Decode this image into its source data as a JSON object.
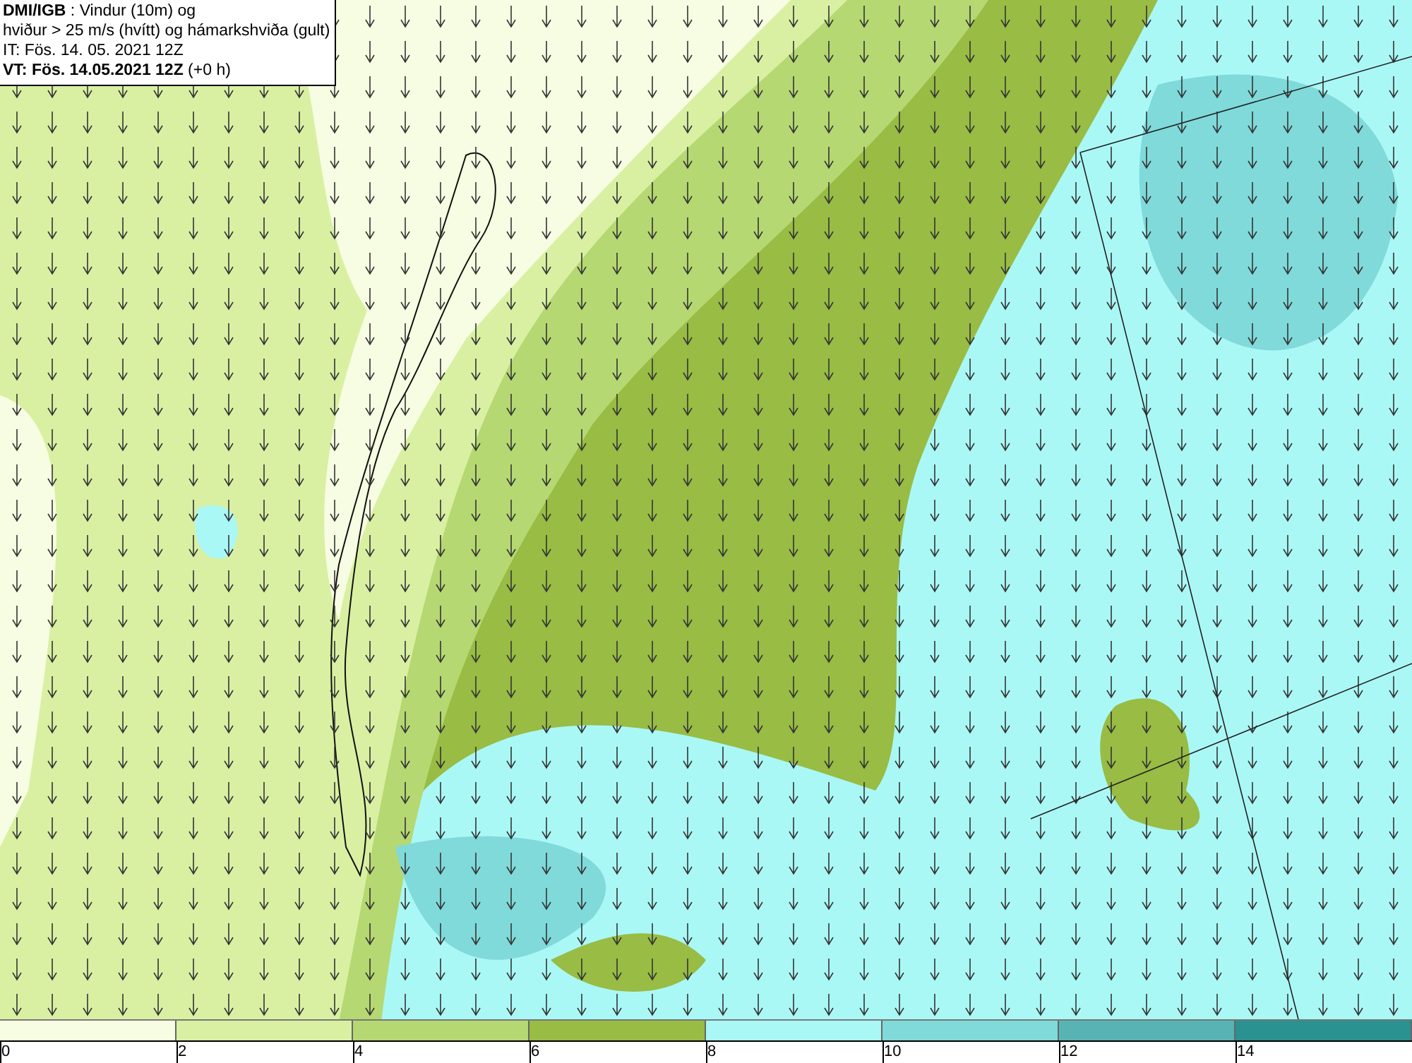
{
  "header": {
    "lines": [
      "**DMI/IGB** : Vindur (10m) og",
      "hviður > 25 m/s (hvítt) og hámarkshviða (gult)",
      "IT: Fös. 14. 05. 2021 12Z",
      "**VT: Fös. 14.05.2021 12Z** (+0 h)"
    ]
  },
  "legend": {
    "bins": [
      {
        "label": "0",
        "color": "#f7fde2"
      },
      {
        "label": "2",
        "color": "#d9f0a3"
      },
      {
        "label": "4",
        "color": "#b6d872"
      },
      {
        "label": "6",
        "color": "#98bc44"
      },
      {
        "label": "8",
        "color": "#aaf8f6"
      },
      {
        "label": "10",
        "color": "#80dada"
      },
      {
        "label": "12",
        "color": "#58b4b4"
      },
      {
        "label": "14",
        "color": "#2a9290"
      }
    ]
  }
}
